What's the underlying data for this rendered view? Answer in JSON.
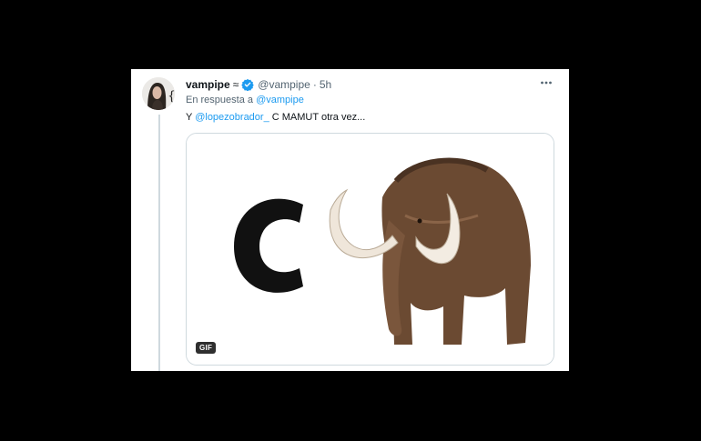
{
  "tweet": {
    "author": {
      "display_name": "vampipe",
      "name_emoji": "≈",
      "handle": "@vampipe",
      "verified": true
    },
    "separator": "·",
    "time": "5h",
    "reply_to": {
      "prefix": "En respuesta a",
      "handle": "@vampipe"
    },
    "text": {
      "prefix": "Y",
      "mention": "@lopezobrador_",
      "body": "C MAMUT otra vez..."
    },
    "media": {
      "badge": "GIF",
      "alt_icon": "mammoth-illustration"
    }
  },
  "colors": {
    "link": "#1d9bf0",
    "verified": "#1d9bf0",
    "secondary_text": "#536471"
  },
  "icons": {
    "more": "more-horizontal-icon",
    "verified": "verified-badge-icon"
  }
}
